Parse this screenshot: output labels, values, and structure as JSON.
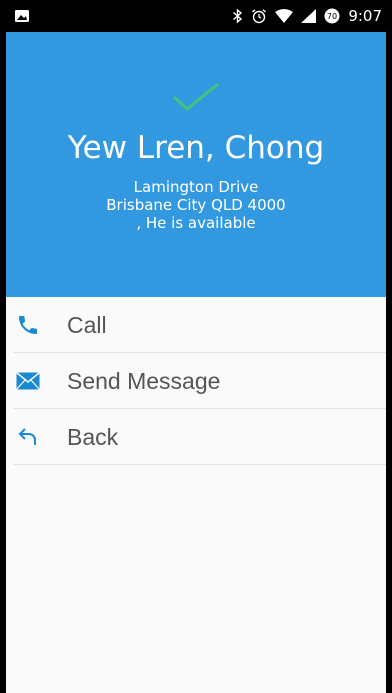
{
  "status_bar": {
    "time": "9:07",
    "icons": [
      "image-icon",
      "bluetooth-icon",
      "alarm-icon",
      "wifi-icon",
      "signal-icon",
      "battery-icon"
    ]
  },
  "contact": {
    "name": "Yew Lren, Chong",
    "address_line1": "Lamington Drive",
    "address_line2": "Brisbane City QLD 4000",
    "availability": ", He is available"
  },
  "actions": [
    {
      "label": "Call",
      "icon": "phone-icon"
    },
    {
      "label": "Send Message",
      "icon": "mail-icon"
    },
    {
      "label": "Back",
      "icon": "back-arrow-icon"
    }
  ],
  "colors": {
    "header_blue": "#3299e0",
    "check_green": "#3fc47e",
    "icon_blue": "#1a88d2",
    "text_gray": "#555555"
  }
}
